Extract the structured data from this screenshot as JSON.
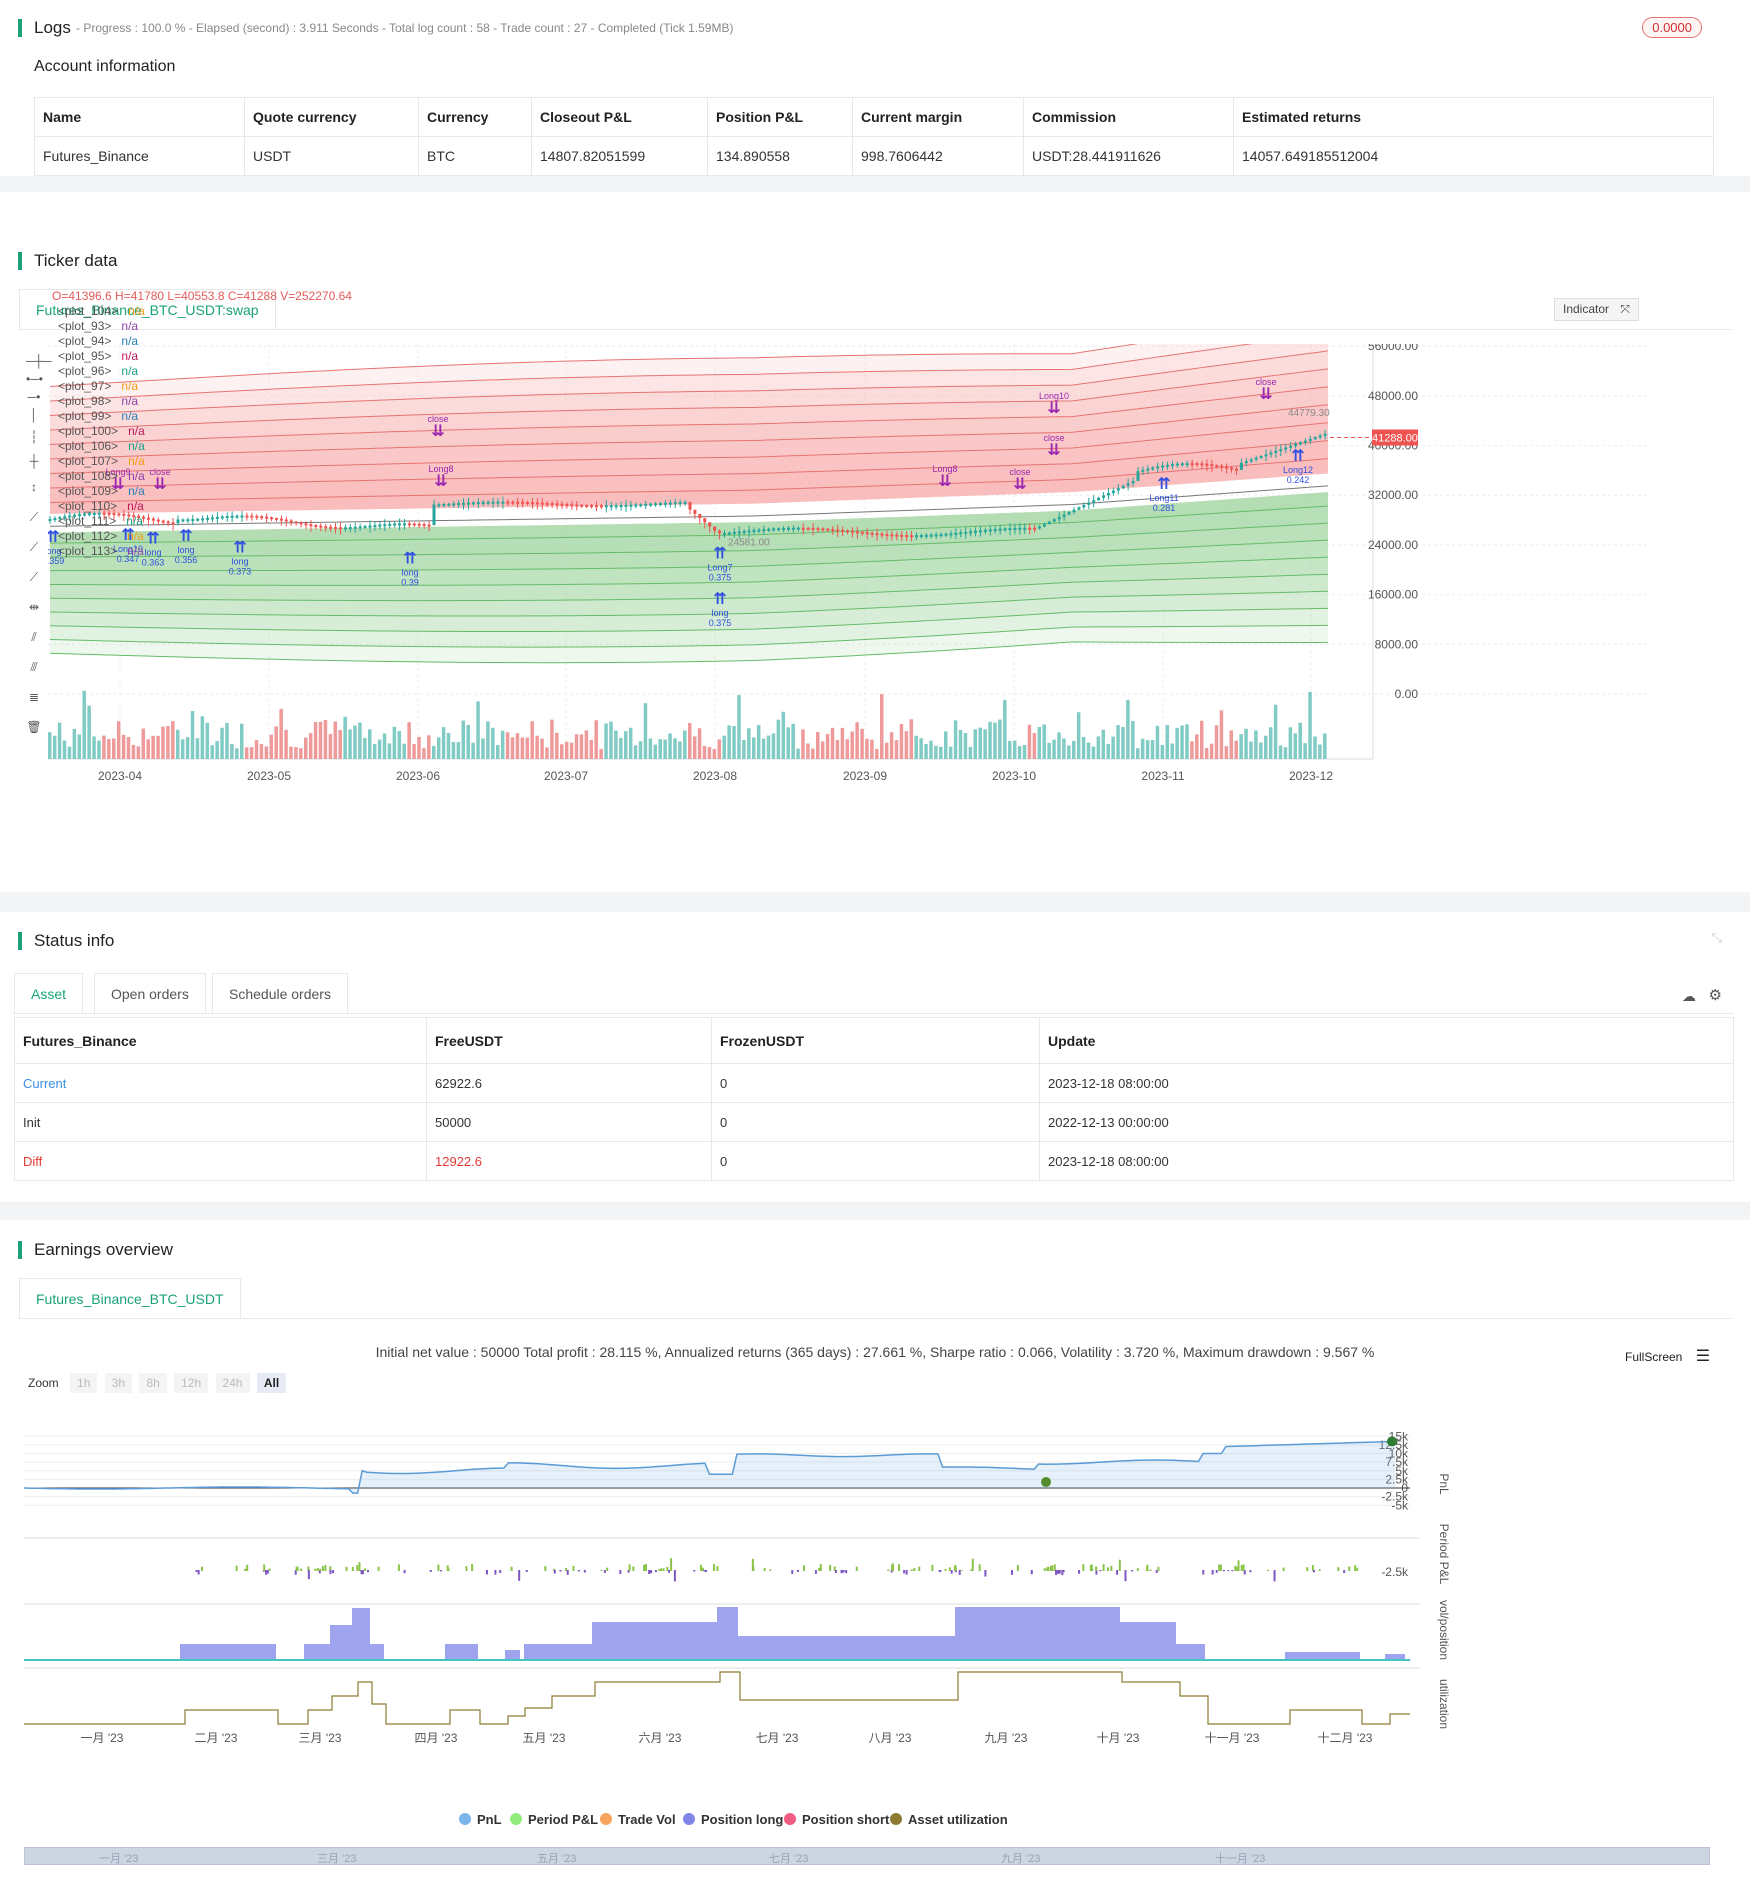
{
  "logs": {
    "title": "Logs",
    "subtitle": "- Progress : 100.0 % - Elapsed (second) : 3.911  Seconds - Total log count : 58 - Trade count : 27 - Completed (Tick 1.59MB)",
    "badge": "0.0000"
  },
  "account": {
    "title": "Account information",
    "headers": [
      "Name",
      "Quote currency",
      "Currency",
      "Closeout P&L",
      "Position P&L",
      "Current margin",
      "Commission",
      "Estimated returns"
    ],
    "row": [
      "Futures_Binance",
      "USDT",
      "BTC",
      "14807.82051599",
      "134.890558",
      "998.7606442",
      "USDT:28.441911626",
      "14057.649185512004"
    ]
  },
  "ticker": {
    "title": "Ticker data",
    "tab": "Futures_Binance_BTC_USDT:swap",
    "ohlc": "O=41396.6  H=41780  L=40553.8  C=41288  V=252270.64",
    "indicator_btn": "Indicator",
    "plots": [
      {
        "name": "<plot_104>",
        "val": "n/a",
        "color": "#f39c12"
      },
      {
        "name": "<plot_93>",
        "val": "n/a",
        "color": "#8e44ad"
      },
      {
        "name": "<plot_94>",
        "val": "n/a",
        "color": "#2980b9"
      },
      {
        "name": "<plot_95>",
        "val": "n/a",
        "color": "#c2185b"
      },
      {
        "name": "<plot_96>",
        "val": "n/a",
        "color": "#16a085"
      },
      {
        "name": "<plot_97>",
        "val": "n/a",
        "color": "#f39c12"
      },
      {
        "name": "<plot_98>",
        "val": "n/a",
        "color": "#8e44ad"
      },
      {
        "name": "<plot_99>",
        "val": "n/a",
        "color": "#2980b9"
      },
      {
        "name": "<plot_100>",
        "val": "n/a",
        "color": "#c2185b"
      },
      {
        "name": "<plot_106>",
        "val": "n/a",
        "color": "#16a085"
      },
      {
        "name": "<plot_107>",
        "val": "n/a",
        "color": "#f39c12"
      },
      {
        "name": "<plot_108>",
        "val": "n/a",
        "color": "#8e44ad"
      },
      {
        "name": "<plot_109>",
        "val": "n/a",
        "color": "#2980b9"
      },
      {
        "name": "<plot_110>",
        "val": "n/a",
        "color": "#c2185b"
      },
      {
        "name": "<plot_111>",
        "val": "n/a",
        "color": "#16a085"
      },
      {
        "name": "<plot_112>",
        "val": "n/a",
        "color": "#f39c12"
      },
      {
        "name": "<plot_113>",
        "val": "n/a",
        "color": "#8e44ad"
      }
    ],
    "y_ticks": [
      "56000.00",
      "48000.00",
      "40000.00",
      "32000.00",
      "24000.00",
      "16000.00",
      "8000.00",
      "0.00"
    ],
    "x_ticks": [
      "2023-04",
      "2023-05",
      "2023-06",
      "2023-07",
      "2023-08",
      "2023-09",
      "2023-10",
      "2023-11",
      "2023-12"
    ],
    "price_tag": "41288.00",
    "high_label": "44779.30",
    "low_label": "24581.00",
    "labels": {
      "long": "long",
      "close": "close",
      "v1": "0.375",
      "v2": "0.39",
      "v3": "0.373",
      "v4": "0.356",
      "v5": "0.363",
      "v6": "0.347",
      "v7": "0.359",
      "v8": "0.281",
      "v9": "0.242",
      "l7": "Long7",
      "l8": "Long8",
      "l9": "Long9",
      "l10": "Long10",
      "l11": "Long11",
      "l12": "Long12"
    }
  },
  "status": {
    "title": "Status info",
    "tabs": [
      "Asset",
      "Open orders",
      "Schedule orders"
    ],
    "headers": [
      "Futures_Binance",
      "FreeUSDT",
      "FrozenUSDT",
      "Update"
    ],
    "rows": [
      [
        "Current",
        "62922.6",
        "0",
        "2023-12-18 08:00:00"
      ],
      [
        "Init",
        "50000",
        "0",
        "2022-12-13 00:00:00"
      ],
      [
        "Diff",
        "12922.6",
        "0",
        "2023-12-18 08:00:00"
      ]
    ]
  },
  "earnings": {
    "title": "Earnings overview",
    "tab": "Futures_Binance_BTC_USDT",
    "summary": "Initial net value : 50000  Total profit : 28.115 %, Annualized returns (365 days) : 27.661 %, Sharpe ratio : 0.066, Volatility : 3.720 %, Maximum drawdown : 9.567 %",
    "fullscreen": "FullScreen",
    "zoom_label": "Zoom",
    "zoom_opts": [
      "1h",
      "3h",
      "8h",
      "12h",
      "24h",
      "All"
    ],
    "pnl_ticks": [
      "15k",
      "12.5k",
      "10k",
      "7.5k",
      "5k",
      "2.5k",
      "0",
      "-2.5k",
      "-5k"
    ],
    "period_tick": "-2.5k",
    "axis_titles": [
      "PnL",
      "Period P&L",
      "vol/position",
      "utilization"
    ],
    "months": [
      "一月 '23",
      "二月 '23",
      "三月 '23",
      "四月 '23",
      "五月 '23",
      "六月 '23",
      "七月 '23",
      "八月 '23",
      "九月 '23",
      "十月 '23",
      "十一月 '23",
      "十二月 '23"
    ],
    "nav_months": [
      "一月 '23",
      "三月 '23",
      "五月 '23",
      "七月 '23",
      "九月 '23",
      "十一月 '23"
    ],
    "legend": [
      {
        "label": "PnL",
        "color": "#7cb5ec"
      },
      {
        "label": "Period P&L",
        "color": "#90ed7d"
      },
      {
        "label": "Trade Vol",
        "color": "#f7a35c"
      },
      {
        "label": "Position long",
        "color": "#8085e9"
      },
      {
        "label": "Position short",
        "color": "#f15c80"
      },
      {
        "label": "Asset utilization",
        "color": "#8d7a34"
      }
    ]
  }
}
